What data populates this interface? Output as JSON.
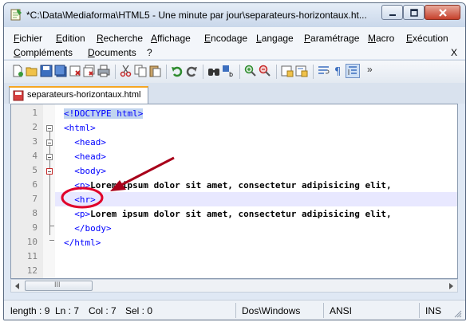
{
  "window": {
    "title": "*C:\\Data\\Mediaforma\\HTML5 - Une minute par jour\\separateurs-horizontaux.ht..."
  },
  "menu": {
    "row1": [
      "Fichier",
      "Edition",
      "Recherche",
      "Affichage",
      "Encodage",
      "Langage",
      "Paramétrage",
      "Macro",
      "Exécution"
    ],
    "row2": [
      "Compléments",
      "Documents",
      "?"
    ],
    "close_glyph": "X"
  },
  "tab": {
    "label": "separateurs-horizontaux.html"
  },
  "editor": {
    "line_numbers": [
      "1",
      "2",
      "3",
      "4",
      "5",
      "6",
      "7",
      "8",
      "9",
      "10",
      "11",
      "12"
    ],
    "lines": [
      {
        "text": "<!DOCTYPE html>"
      },
      {
        "text": "<html>"
      },
      {
        "text": "  <head>"
      },
      {
        "text": "  <head>"
      },
      {
        "text": "  <body>"
      },
      {
        "pre": "  ",
        "tag": "<p>",
        "rest": "Lorem ipsum dolor sit amet, consectetur adipisicing elit,"
      },
      {
        "text": "  <hr>"
      },
      {
        "pre": "  ",
        "tag": "<p>",
        "rest": "Lorem ipsum dolor sit amet, consectetur adipisicing elit,"
      },
      {
        "text": "  </body>"
      },
      {
        "text": "</html>"
      },
      {
        "text": ""
      },
      {
        "text": ""
      }
    ],
    "annotation_color": "#e0002a",
    "arrow_color": "#a8001a"
  },
  "scrollbar": {
    "thumb_glyph": "III"
  },
  "status": {
    "length": "length : 9",
    "line": "Ln : 7",
    "col": "Col : 7",
    "sel": "Sel : 0",
    "eol": "Dos\\Windows",
    "encoding": "ANSI",
    "mode": "INS"
  },
  "colors": {
    "tag": "#0000ff",
    "current_line": "#e8e8ff",
    "tab_accent": "#f5a623"
  }
}
